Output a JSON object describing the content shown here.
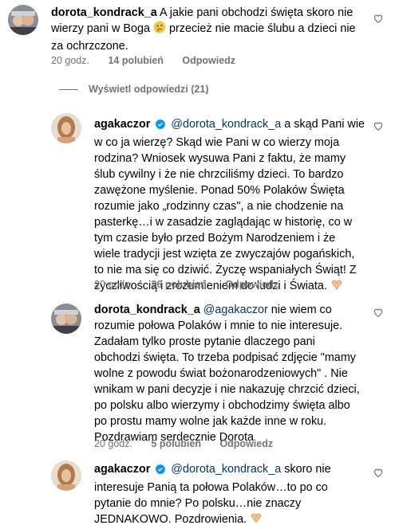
{
  "comments": [
    {
      "username": "dorota_kondrack_a",
      "text_lines": [
        "A jakie pani obchodzi święta skoro nie",
        "wierzy pani w Boga",
        "przecież nie macie ślubu a dzieci nie",
        "za ochrzczone."
      ],
      "time": "20 godz.",
      "likes": "14 polubień",
      "reply": "Odpowiedz"
    },
    {
      "username": "agakaczor",
      "mention": "@dorota_kondrack_a",
      "text_lines": [
        "a skąd Pani wie",
        "w co ja wierzę? Skąd wie Pani w co wierzy moja",
        "rodzina? Wniosek wysuwa Pani z faktu, że mamy",
        "ślub cywilny i że nie chrzciliśmy dzieci. To bardzo",
        "zawężone myślenie. Ponad 50% Polaków Święta",
        "rozumie jako „rodzinny czas\", a nie chodzenie na",
        "pasterkę…i w zasadzie zaglądając w historię, co w",
        "tym czasie było przed Bożym Narodzeniem i że",
        "wiele tradycji jest wzięta ze zwyczajów pogańskich,",
        "to nie ma się co dziwić. Życzę wspaniałych Świąt! Z",
        "życzliwością i zrozumieniem do ludzi i Świata."
      ],
      "time": "20 godz.",
      "likes": "36 polubień",
      "reply": "Odpowiedz"
    },
    {
      "username": "dorota_kondrack_a",
      "mention": "@agakaczor",
      "text_lines": [
        "nie wiem co",
        "rozumie połowa Polaków i mnie to nie interesuje.",
        "Zadałam tylko proste pytanie dlaczego pani",
        "obchodzi święta. To trzeba podpisać zdjęcie \"mamy",
        "wolne z powodu świat bożonarodzeniowych\" . Nie",
        "wnikam w pani decyzje i nie nakazuję chrzcić dzieci,",
        "po polsku albo wierzymy i obchodzimy święta albo",
        "po prostu mamy wolne jak każde inne w roku.",
        "Pozdrawiam serdecznie Dorota"
      ],
      "time": "20 godz.",
      "likes": "5 polubień",
      "reply": "Odpowiedz"
    },
    {
      "username": "agakaczor",
      "mention": "@dorota_kondrack_a",
      "text_lines": [
        "skoro nie",
        "interesuje Panią ta połowa Polaków…to po co",
        "pytanie do mnie? Po polsku…nie znaczy",
        "JEDNAKOWO. Pozdrowienia."
      ]
    }
  ],
  "view_replies": "Wyświetl odpowiedzi (21)",
  "colors": {
    "muted": "#737373",
    "mention": "#00376b",
    "verified": "#0095f6"
  },
  "icons": [
    "heart-icon",
    "verified-badge-icon",
    "thinking-face-emoji",
    "heart-hands-emoji"
  ]
}
